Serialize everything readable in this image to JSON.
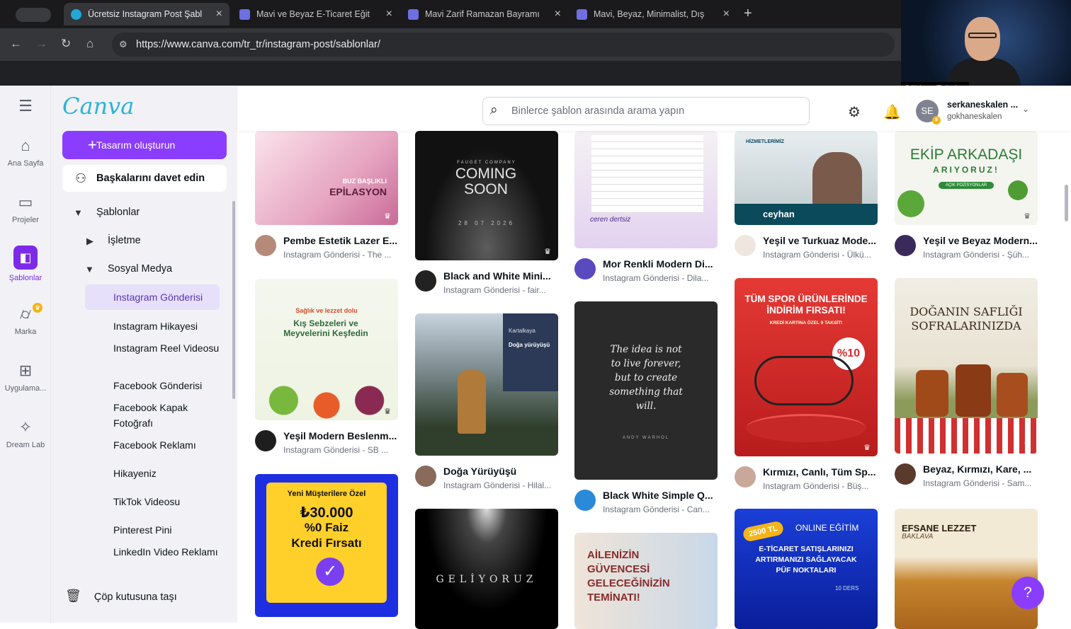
{
  "browser": {
    "tabs": [
      {
        "title": "Ücretsiz Instagram Post Şabl",
        "active": true
      },
      {
        "title": "Mavi ve Beyaz E-Ticaret Eğit",
        "active": false
      },
      {
        "title": "Mavi Zarif Ramazan Bayramı",
        "active": false
      },
      {
        "title": "Mavi, Beyaz, Minimalist, Dış",
        "active": false
      }
    ],
    "url": "https://www.canva.com/tr_tr/instagram-post/sablonlar/",
    "webcam_name": "Gökhan Eskalen"
  },
  "rail": [
    {
      "label": "Ana Sayfa",
      "icon": "home-icon"
    },
    {
      "label": "Projeler",
      "icon": "folder-icon"
    },
    {
      "label": "Şablonlar",
      "icon": "templates-icon",
      "active": true
    },
    {
      "label": "Marka",
      "icon": "brand-icon"
    },
    {
      "label": "Uygulama...",
      "icon": "apps-icon"
    },
    {
      "label": "Dream Lab",
      "icon": "dream-lab-icon"
    }
  ],
  "sidebar": {
    "logo": "Canva",
    "create_button": "Tasarım oluşturun",
    "invite_button": "Başkalarını davet edin",
    "templates_label": "Şablonlar",
    "business_label": "İşletme",
    "social_label": "Sosyal Medya",
    "social_items": [
      "Instagram Gönderisi",
      "Instagram Hikayesi",
      "Instagram Reel Videosu",
      "Facebook Gönderisi",
      "Facebook Kapak Fotoğrafı",
      "Facebook Reklamı",
      "Hikayeniz",
      "TikTok Videosu",
      "Pinterest Pini",
      "LinkedIn Video Reklamı"
    ],
    "trash_label": "Çöp kutusuna taşı"
  },
  "topbar": {
    "search_placeholder": "Binlerce şablon arasında arama yapın",
    "user_initials": "SE",
    "user_name": "serkaneskalen ...",
    "user_handle": "gokhaneskalen"
  },
  "cards": {
    "c1": {
      "title": "Pembe Estetik Lazer E...",
      "sub": "Instagram Gönderisi - The ...",
      "overlay1": "BUZ BAŞLIKLI",
      "overlay2": "EPİLASYON"
    },
    "c2": {
      "title": "Yeşil Modern Beslenm...",
      "sub": "Instagram Gönderisi - SB ...",
      "overlay1": "Sağlık ve lezzet dolu",
      "overlay2": "Kış Sebzeleri ve Meyvelerini Keşfedin"
    },
    "c3": {
      "overlay1": "Yeni Müşterilere Özel",
      "overlay2": "₺30.000",
      "overlay3": "%0 Faiz",
      "overlay4": "Kredi Fırsatı"
    },
    "c4": {
      "title": "Black and White Mini...",
      "sub": "Instagram Gönderisi - fair...",
      "overlay1": "FAUGET COMPANY",
      "overlay2": "COMING SOON",
      "overlay3": "28 07 2026"
    },
    "c5": {
      "title": "Doğa Yürüyüşü",
      "sub": "Instagram Gönderisi - Hilal...",
      "overlay1": "Kartalkaya",
      "overlay2": "Doğa yürüyüşü"
    },
    "c6": {
      "overlay1": "GELİYORUZ"
    },
    "c7": {
      "title": "Mor Renkli Modern Di...",
      "sub": "Instagram Gönderisi - Dila...",
      "overlay1": "ceren dertsiz"
    },
    "c8": {
      "title": "Black White Simple Q...",
      "sub": "Instagram Gönderisi - Can...",
      "overlay1": "The idea is not to live forever, but to create something that will.",
      "overlay2": "ANDY WARHOL"
    },
    "c9": {
      "overlay1": "AİLENİZİN GÜVENCESİ GELECEĞİNİZİN TEMİNATI!"
    },
    "c10": {
      "title": "Yeşil ve Turkuaz Mode...",
      "sub": "Instagram Gönderisi - Ülkü...",
      "overlay1": "HİZMETLERİMİZ",
      "overlay2": "ceyhan"
    },
    "c11": {
      "title": "Kırmızı, Canlı, Tüm Sp...",
      "sub": "Instagram Gönderisi - Büş...",
      "overlay1": "TÜM SPOR ÜRÜNLERİNDE İNDİRİM FIRSATI!",
      "overlay2": "KREDİ KARTINA ÖZEL 9 TAKSİT!",
      "overlay3": "%10"
    },
    "c12": {
      "overlay1": "2500 TL",
      "overlay2": "ONLINE EĞİTİM",
      "overlay3": "E-TİCARET SATIŞLARINIZI ARTIRMANIZI SAĞLAYACAK PÜF NOKTALARI",
      "overlay4": "10 DERS"
    },
    "c13": {
      "title": "Yeşil ve Beyaz Modern...",
      "sub": "Instagram Gönderisi - Şüh...",
      "overlay1": "EKİP ARKADAŞI",
      "overlay2": "ARIYORUZ!",
      "overlay3": "AÇIK POZİSYONLAR"
    },
    "c14": {
      "title": "Beyaz, Kırmızı, Kare, ...",
      "sub": "Instagram Gönderisi - Sam...",
      "overlay1": "DOĞANIN SAFLIĞI SOFRALARINIZDA"
    },
    "c15": {
      "overlay1": "EFSANE LEZZET",
      "overlay2": "BAKLAVA"
    }
  },
  "help_label": "?"
}
